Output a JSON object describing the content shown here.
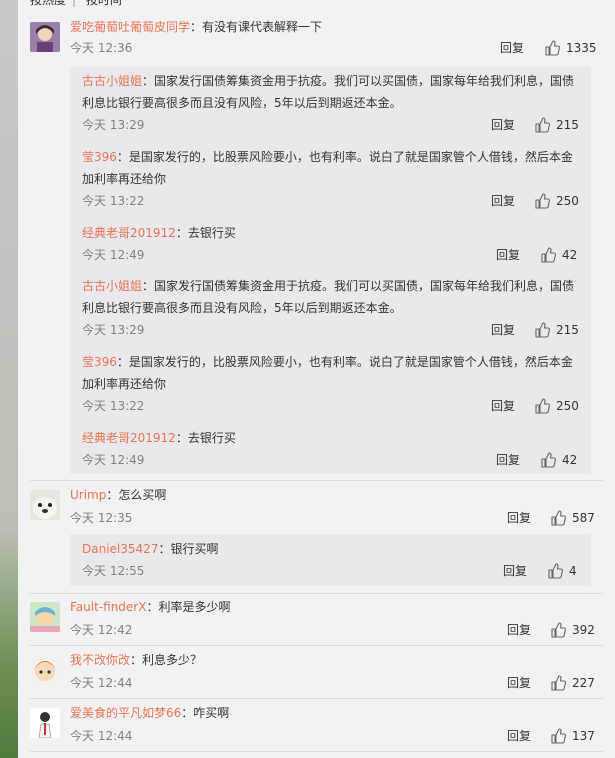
{
  "sort_bar": {
    "by_hot": "按热度",
    "by_time": "按时间"
  },
  "comments": [
    {
      "user": "爱吃葡萄吐葡萄皮同学",
      "text": "：有没有课代表解释一下",
      "time": "今天 12:36",
      "reply": "回复",
      "likes": "1335",
      "replies": [
        {
          "user": "古古小姐姐",
          "text": "：国家发行国债筹集资金用于抗疫。我们可以买国债，国家每年给我们利息，国债利息比银行要高很多而且没有风险，5年以后到期返还本金。",
          "time": "今天 13:29",
          "reply": "回复",
          "likes": "215"
        },
        {
          "user": "莹396",
          "text": "：是国家发行的，比股票风险要小，也有利率。说白了就是国家管个人借钱，然后本金加利率再还给你",
          "time": "今天 13:22",
          "reply": "回复",
          "likes": "250"
        },
        {
          "user": "经典老哥201912",
          "text": "：去银行买",
          "time": "今天 12:49",
          "reply": "回复",
          "likes": "42"
        },
        {
          "user": "古古小姐姐",
          "text": "：国家发行国债筹集资金用于抗疫。我们可以买国债，国家每年给我们利息，国债利息比银行要高很多而且没有风险，5年以后到期返还本金。",
          "time": "今天 13:29",
          "reply": "回复",
          "likes": "215"
        },
        {
          "user": "莹396",
          "text": "：是国家发行的，比股票风险要小，也有利率。说白了就是国家管个人借钱，然后本金加利率再还给你",
          "time": "今天 13:22",
          "reply": "回复",
          "likes": "250"
        },
        {
          "user": "经典老哥201912",
          "text": "：去银行买",
          "time": "今天 12:49",
          "reply": "回复",
          "likes": "42"
        }
      ]
    },
    {
      "user": "Urimp",
      "text": "：怎么买啊",
      "time": "今天 12:35",
      "reply": "回复",
      "likes": "587",
      "replies": [
        {
          "user": "Daniel35427",
          "text": "：银行买啊",
          "time": "今天 12:55",
          "reply": "回复",
          "likes": "4"
        }
      ]
    },
    {
      "user": "Fault-finderX",
      "text": "：利率是多少啊",
      "time": "今天 12:42",
      "reply": "回复",
      "likes": "392",
      "replies": []
    },
    {
      "user": "我不改你改",
      "text": "：利息多少？",
      "time": "今天 12:44",
      "reply": "回复",
      "likes": "227",
      "replies": []
    },
    {
      "user": "爱美食的平凡如梦66",
      "text": "：咋买啊",
      "time": "今天 12:44",
      "reply": "回复",
      "likes": "137",
      "replies": []
    }
  ],
  "colors": {
    "username": "#eb7350",
    "meta": "#808080",
    "panel": "#f2f2f5",
    "reply_box": "#e9e9ed"
  },
  "icons": {
    "like": "thumbs-up-icon"
  }
}
